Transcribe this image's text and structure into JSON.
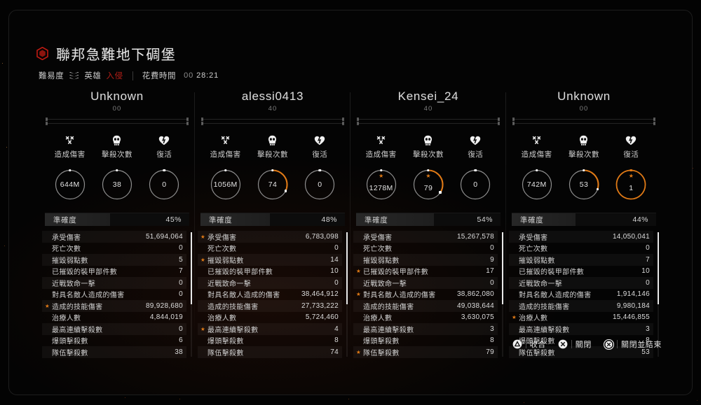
{
  "header": {
    "icon": "hex-skull-icon",
    "mission_title": "聯邦急難地下碉堡",
    "difficulty_label": "難易度",
    "difficulty_value": "英雄",
    "modifier": "入侵",
    "time_label": "花費時間",
    "time_prefix": "00",
    "time_value": "28:21"
  },
  "gauge_labels": {
    "damage": "造成傷害",
    "kills": "擊殺次數",
    "revives": "復活"
  },
  "accuracy_label": "準確度",
  "stat_names": [
    "承受傷害",
    "死亡次數",
    "摧毀弱點數",
    "已摧毀的裝甲部件數",
    "近戰致命一擊",
    "對具名敵人造成的傷害",
    "造成的技能傷害",
    "治療人數",
    "最高連續擊殺數",
    "爆頭擊殺數",
    "隊伍擊殺數"
  ],
  "players": [
    {
      "name": "Unknown",
      "level": "00",
      "damage": "644M",
      "damage_pct": 0,
      "damage_star": false,
      "kills": "38",
      "kills_pct": 0,
      "kills_star": false,
      "revives": "0",
      "revives_pct": 0,
      "revives_star": false,
      "accuracy": "45%",
      "accuracy_pct": 45,
      "stats": [
        {
          "value": "51,694,064",
          "star": false
        },
        {
          "value": "0",
          "star": false
        },
        {
          "value": "5",
          "star": false
        },
        {
          "value": "7",
          "star": false
        },
        {
          "value": "0",
          "star": false
        },
        {
          "value": "0",
          "star": false
        },
        {
          "value": "89,928,680",
          "star": true
        },
        {
          "value": "4,844,019",
          "star": false
        },
        {
          "value": "0",
          "star": false
        },
        {
          "value": "6",
          "star": false
        },
        {
          "value": "38",
          "star": false
        }
      ],
      "scroll_thumb_pct": 58
    },
    {
      "name": "alessi0413",
      "level": "40",
      "damage": "1056M",
      "damage_pct": 0,
      "damage_star": false,
      "kills": "74",
      "kills_pct": 32,
      "kills_star": false,
      "revives": "0",
      "revives_pct": 0,
      "revives_star": false,
      "accuracy": "48%",
      "accuracy_pct": 48,
      "stats": [
        {
          "value": "6,783,098",
          "star": true
        },
        {
          "value": "0",
          "star": false
        },
        {
          "value": "14",
          "star": true
        },
        {
          "value": "10",
          "star": false
        },
        {
          "value": "0",
          "star": false
        },
        {
          "value": "38,464,912",
          "star": false
        },
        {
          "value": "27,733,222",
          "star": false
        },
        {
          "value": "5,724,460",
          "star": false
        },
        {
          "value": "4",
          "star": true
        },
        {
          "value": "8",
          "star": false
        },
        {
          "value": "74",
          "star": false
        }
      ],
      "scroll_thumb_pct": 58
    },
    {
      "name": "Kensei_24",
      "level": "40",
      "damage": "1278M",
      "damage_pct": 0,
      "damage_star": true,
      "kills": "79",
      "kills_pct": 34,
      "kills_star": true,
      "revives": "0",
      "revives_pct": 0,
      "revives_star": false,
      "accuracy": "54%",
      "accuracy_pct": 54,
      "stats": [
        {
          "value": "15,267,578",
          "star": false
        },
        {
          "value": "0",
          "star": false
        },
        {
          "value": "9",
          "star": false
        },
        {
          "value": "17",
          "star": true
        },
        {
          "value": "0",
          "star": false
        },
        {
          "value": "38,862,080",
          "star": true
        },
        {
          "value": "49,038,644",
          "star": false
        },
        {
          "value": "3,630,075",
          "star": false
        },
        {
          "value": "3",
          "star": false
        },
        {
          "value": "8",
          "star": false
        },
        {
          "value": "79",
          "star": true
        }
      ],
      "scroll_thumb_pct": 58
    },
    {
      "name": "Unknown",
      "level": "00",
      "damage": "742M",
      "damage_pct": 0,
      "damage_star": false,
      "kills": "53",
      "kills_pct": 30,
      "kills_star": false,
      "revives": "1",
      "revives_pct": 100,
      "revives_star": true,
      "accuracy": "44%",
      "accuracy_pct": 44,
      "stats": [
        {
          "value": "14,050,041",
          "star": false
        },
        {
          "value": "0",
          "star": false
        },
        {
          "value": "7",
          "star": false
        },
        {
          "value": "10",
          "star": false
        },
        {
          "value": "0",
          "star": false
        },
        {
          "value": "1,914,146",
          "star": false
        },
        {
          "value": "9,980,184",
          "star": false
        },
        {
          "value": "15,446,855",
          "star": true
        },
        {
          "value": "3",
          "star": false
        },
        {
          "value": "8",
          "star": false
        },
        {
          "value": "53",
          "star": false
        }
      ],
      "scroll_thumb_pct": 58
    }
  ],
  "footer": {
    "collapse": {
      "glyph": "triangle-button-icon",
      "label": "收合"
    },
    "close": {
      "glyph": "cross-circle-icon",
      "label": "關閉"
    },
    "close_end": {
      "glyph": "cross-circle-ring-icon",
      "label": "關閉並結束"
    }
  },
  "colors": {
    "accent": "#e07a16",
    "danger": "#b61f18",
    "text": "#dedede"
  }
}
